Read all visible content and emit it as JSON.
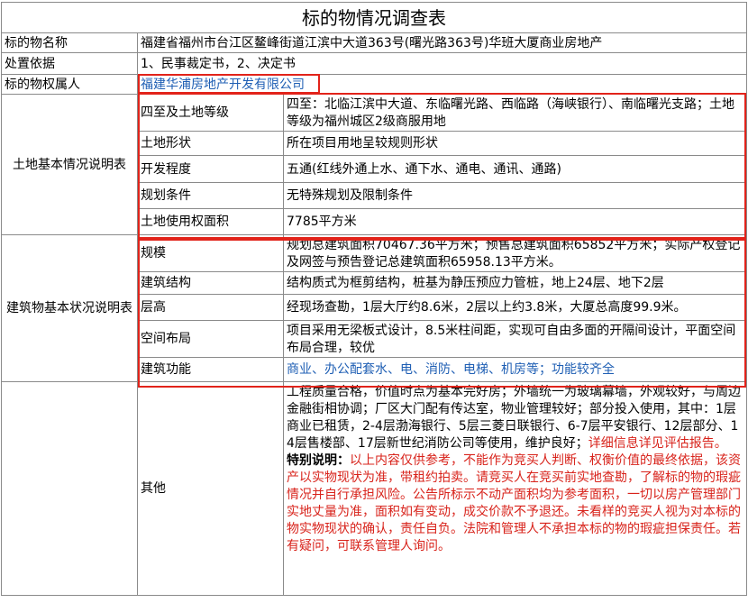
{
  "title": "标的物情况调查表",
  "rows": {
    "name": {
      "label": "标的物名称",
      "value": "福建省福州市台江区鳌峰街道江滨中大道363号(曙光路363号)华班大厦商业房地产"
    },
    "basis": {
      "label": "处置依据",
      "value": "1、民事裁定书，2、决定书"
    },
    "owner": {
      "label": "标的物权属人",
      "value": "福建华浦房地产开发有限公司"
    }
  },
  "land": {
    "section_label": "土地基本情况说明表",
    "items": [
      {
        "label": "四至及土地等级",
        "value": "四至：北临江滨中大道、东临曙光路、西临路（海峡银行）、南临曙光支路；土地等级为福州城区2级商服用地"
      },
      {
        "label": "土地形状",
        "value": "所在项目用地呈较规则形状"
      },
      {
        "label": "开发程度",
        "value": "五通(红线外通上水、通下水、通电、通讯、通路)"
      },
      {
        "label": "规划条件",
        "value": "无特殊规划及限制条件"
      },
      {
        "label": "土地使用权面积",
        "value": "7785平方米"
      }
    ]
  },
  "building": {
    "section_label": "建筑物基本状况说明表",
    "items": [
      {
        "label": "规模",
        "value": "规划总建筑面积70467.36平方米；预售总建筑面积65852平方米；实际产权登记及网签与预告登记总建筑面积65958.13平方米。"
      },
      {
        "label": "建筑结构",
        "value": "结构质式为框剪结构，桩基为静压预应力管桩，地上24层、地下2层"
      },
      {
        "label": "层高",
        "value": "经现场查勘，1层大厅约8.6米，2层以上约3.8米，大厦总高度99.9米。"
      },
      {
        "label": "空间布局",
        "value": "项目采用无梁板式设计，8.5米柱间距，实现可自由多面的开隔间设计，平面空间布局合理，较优"
      },
      {
        "label": "建筑功能",
        "value": "商业、办公配套水、电、消防、电梯、机房等；功能较齐全"
      }
    ]
  },
  "other": {
    "label": "其他",
    "description": "工程质量合格，价值时点为基本完好房；外墙统一为玻璃幕墙，外观较好，与周边金融街相协调；厂区大门配有传达室，物业管理较好；部分投入使用，其中：1层商业已租赁，2-4层渤海银行、5层三菱日联银行、6-7层平安银行、12层部分、14层售楼部、17层新世纪消防公司等使用，维护良好；",
    "detail_note": "详细信息详见评估报告。",
    "special_label": "特别说明：",
    "special_text": "以上内容仅供参考，不能作为竞买人判断、权衡价值的最终依据，该资产以实物现状为准，带租约拍卖。请竞买人在竞买前实地查勘，了解标的物的瑕疵情况并自行承担风险。公告所标示不动产面积均为参考面积，一切以房产管理部门实地丈量为准，面积如有变动，成交价款不予退还。未看样的竞买人视为对本标的物实物现状的确认，责任自负。法院和管理人不承担本标的物的瑕疵担保责任。若有疑问，可联系管理人询问。"
  },
  "colors": {
    "highlight_box": "#e2231a",
    "blue_text": "#1f5fb4",
    "red_text": "#d8231b"
  }
}
